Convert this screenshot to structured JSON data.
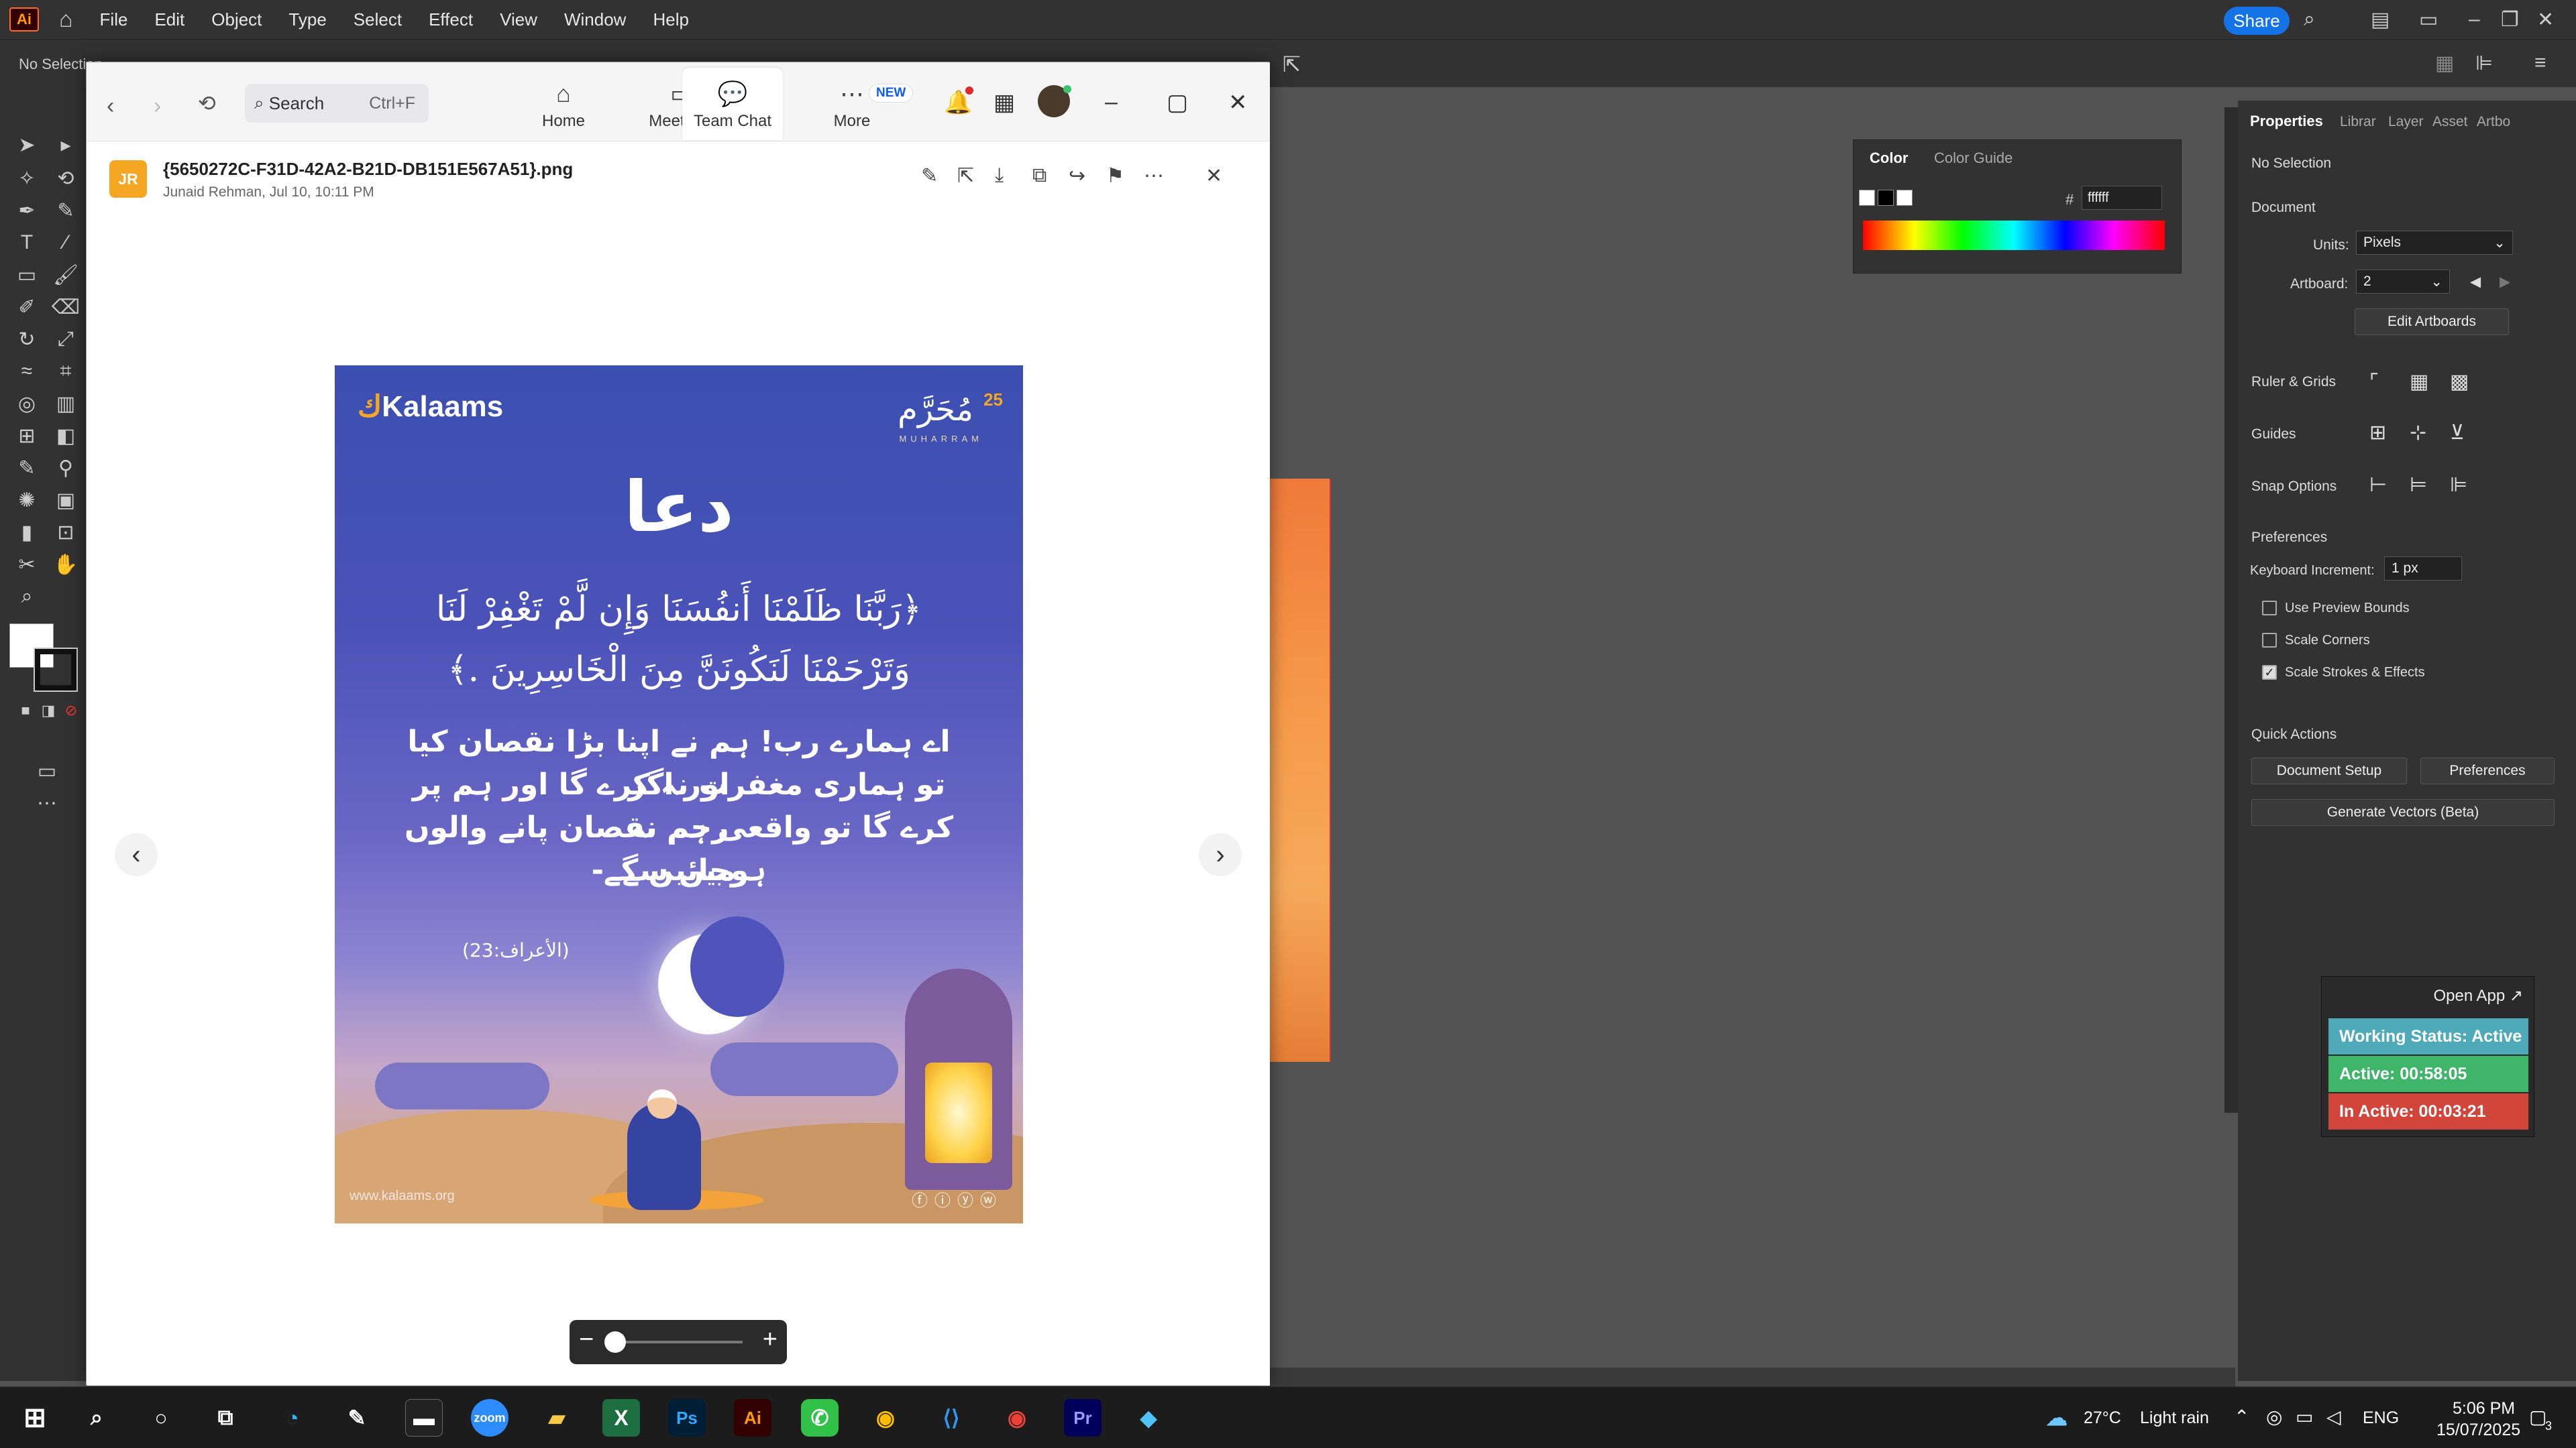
{
  "illustrator": {
    "logo": "Ai",
    "menu": [
      "File",
      "Edit",
      "Object",
      "Type",
      "Select",
      "Effect",
      "View",
      "Window",
      "Help"
    ],
    "share_label": "Share",
    "control_bar_no_selection": "No Selection",
    "color_panel": {
      "tab1": "Color",
      "tab2": "Color Guide",
      "hex_symbol": "#",
      "hex_value": "ffffff"
    },
    "properties": {
      "tabs": [
        "Properties",
        "Librar",
        "Layer",
        "Asset",
        "Artbo"
      ],
      "no_selection": "No Selection",
      "document_label": "Document",
      "units_label": "Units:",
      "units_value": "Pixels",
      "artboard_label": "Artboard:",
      "artboard_value": "2",
      "edit_artboards": "Edit Artboards",
      "ruler_grids": "Ruler & Grids",
      "guides": "Guides",
      "snap_options": "Snap Options",
      "preferences_header": "Preferences",
      "keyboard_increment_label": "Keyboard Increment:",
      "keyboard_increment_value": "1 px",
      "use_preview_bounds": "Use Preview Bounds",
      "scale_corners": "Scale Corners",
      "scale_strokes": "Scale Strokes & Effects",
      "quick_actions": "Quick Actions",
      "document_setup": "Document Setup",
      "preferences_btn": "Preferences",
      "generate_vectors": "Generate Vectors (Beta)"
    }
  },
  "status_widget": {
    "open_app": "Open App ↗",
    "working": "Working Status: Active",
    "active": "Active: 00:58:05",
    "inactive": "In Active: 00:03:21",
    "colors": {
      "working": "#4eaab8",
      "active": "#3fb56a",
      "inactive": "#d2453b"
    }
  },
  "zoom": {
    "search_placeholder": "Search",
    "search_shortcut": "Ctrl+F",
    "tabs": [
      {
        "label": "Home",
        "icon": "⌂"
      },
      {
        "label": "Meetings",
        "icon": "▭"
      },
      {
        "label": "Team Chat",
        "icon": "💬"
      },
      {
        "label": "More",
        "icon": "⋯"
      }
    ],
    "new_badge": "NEW",
    "avatar_initials": "JR",
    "file_name": "{5650272C-F31D-42A2-B21D-DB151E567A51}.png",
    "file_meta": "Junaid Rehman, Jul 10, 10:11 PM"
  },
  "poster": {
    "brand": "Kalaams",
    "muharram": "مُحَرَّم",
    "num": "25",
    "muharram_sub": "MUHARRAM",
    "title": "دعا",
    "arabic_line1": "﴿رَبَّنَا ظَلَمْنَا أَنفُسَنَا وَإِن لَّمْ تَغْفِرْ لَنَا",
    "arabic_line2": "وَتَرْحَمْنَا لَنَكُونَنَّ مِنَ الْخَاسِرِينَ .﴾",
    "urdu_line1": "اے ہمارے رب! ہم نے اپنا بڑا نقصان کیا اور اگر",
    "urdu_line2": "تو ہماری مغفرت نہ کرے گا اور ہم پر رحم نہ",
    "urdu_line3": "کرے گا تو واقعی ہم نقصان پانے والوں میں سے",
    "urdu_line4": "ہوجائیں گے-",
    "reference": "(الأعراف:23)",
    "website": "www.kalaams.org",
    "social": "ⓕⓘⓨⓦ"
  },
  "taskbar": {
    "weather_temp": "27°C",
    "weather_desc": "Light rain",
    "lang": "ENG",
    "time": "5:06 PM",
    "date": "15/07/2025",
    "notif_count": "3"
  }
}
